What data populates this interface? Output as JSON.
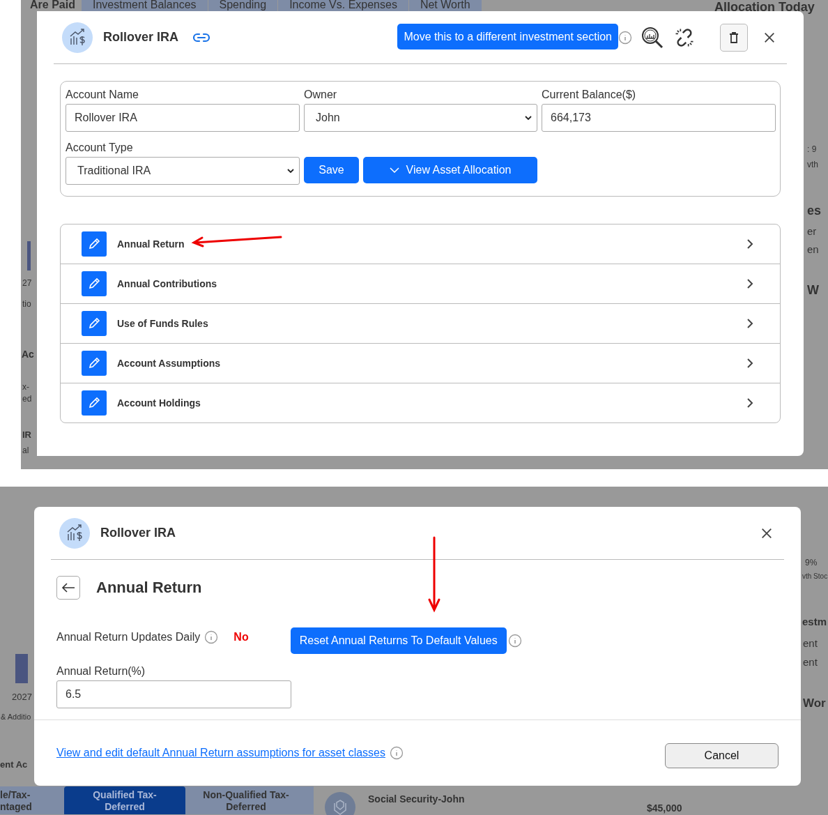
{
  "top": {
    "background": {
      "title": "Are Paid",
      "tabs": [
        {
          "label": "Investment Balances",
          "selected": false
        },
        {
          "label": "Spending",
          "selected": false
        },
        {
          "label": "Income Vs. Expenses",
          "selected": false
        },
        {
          "label": "Net Worth",
          "selected": false
        }
      ],
      "texts": [
        {
          "text": "Allocation Today",
          "kind": "heading"
        },
        {
          "text": "27",
          "kind": "label"
        },
        {
          "text": "tio",
          "kind": "label"
        },
        {
          "text": "Ac",
          "kind": "heading"
        },
        {
          "text": "x-",
          "kind": "label"
        },
        {
          "text": "ed",
          "kind": "label"
        },
        {
          "text": "IR",
          "kind": "heading"
        },
        {
          "text": "al",
          "kind": "label"
        },
        {
          "text": ": 9",
          "kind": "small"
        },
        {
          "text": "vth",
          "kind": "small"
        },
        {
          "text": "es",
          "kind": "heading"
        },
        {
          "text": "er",
          "kind": "label"
        },
        {
          "text": "en",
          "kind": "label"
        },
        {
          "text": "W",
          "kind": "heading"
        }
      ]
    },
    "modal": {
      "title": "Rollover IRA",
      "move_button": "Move this to a different investment section",
      "fields": [
        {
          "label": "Account Name",
          "value": "Rollover IRA",
          "kind": "input"
        },
        {
          "label": "Owner",
          "value": "John",
          "kind": "select"
        },
        {
          "label": "Current Balance($)",
          "value": "664,173",
          "kind": "input"
        },
        {
          "label": "Account Type",
          "value": "Traditional IRA",
          "kind": "select"
        }
      ],
      "save_button": "Save",
      "allocation_button": "View Asset Allocation",
      "sections": [
        "Annual Return",
        "Annual Contributions",
        "Use of Funds Rules",
        "Account Assumptions",
        "Account Holdings"
      ]
    }
  },
  "bottom": {
    "background": {
      "tabs": [
        {
          "label": "le/Tax-\nntaged",
          "selected": false
        },
        {
          "label": "Qualified Tax-\nDeferred",
          "selected": true
        },
        {
          "label": "Non-Qualified Tax-\nDeferred",
          "selected": false
        }
      ],
      "texts": [
        {
          "text": "2027",
          "kind": "small"
        },
        {
          "text": "& Additio",
          "kind": "small"
        },
        {
          "text": "ent Ac",
          "kind": "heading"
        },
        {
          "text": "9%",
          "kind": "small"
        },
        {
          "text": "vth Stoc",
          "kind": "small"
        },
        {
          "text": "estm",
          "kind": "heading"
        },
        {
          "text": "ent",
          "kind": "label"
        },
        {
          "text": "ent",
          "kind": "label"
        },
        {
          "text": "Wor",
          "kind": "heading"
        },
        {
          "text": "Social Security-John",
          "kind": "bold"
        },
        {
          "text": "$45,000",
          "kind": "bold"
        }
      ]
    },
    "modal": {
      "title": "Rollover IRA",
      "section_title": "Annual Return",
      "updates_label": "Annual Return Updates Daily",
      "updates_value": "No",
      "reset_button": "Reset Annual Returns To Default Values",
      "return_label": "Annual Return(%)",
      "return_value": "6.5",
      "defaults_link": "View and edit default Annual Return assumptions for asset classes",
      "cancel_button": "Cancel"
    }
  }
}
